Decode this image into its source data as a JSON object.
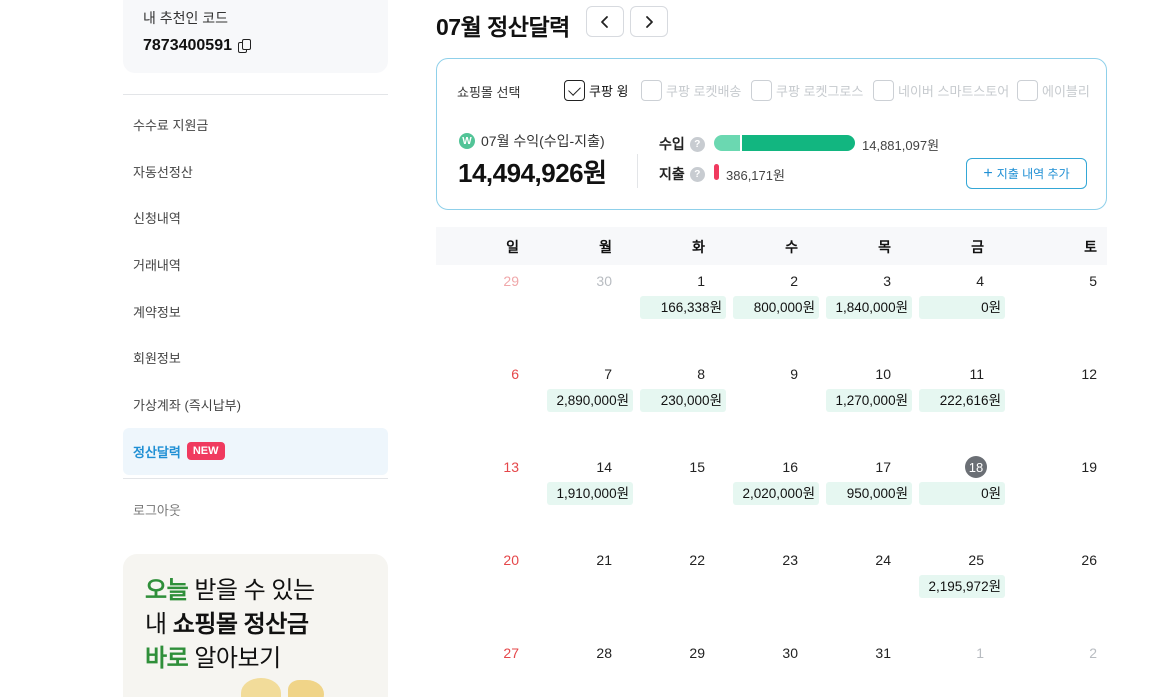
{
  "sidebar": {
    "referral_title": "내 추천인 코드",
    "referral_code": "7873400591",
    "menu": [
      {
        "label": "수수료 지원금",
        "active": false
      },
      {
        "label": "자동선정산",
        "active": false
      },
      {
        "label": "신청내역",
        "active": false
      },
      {
        "label": "거래내역",
        "active": false
      },
      {
        "label": "계약정보",
        "active": false
      },
      {
        "label": "회원정보",
        "active": false
      },
      {
        "label": "가상계좌 (즉시납부)",
        "active": false
      },
      {
        "label": "정산달력",
        "active": true,
        "badge": "NEW"
      }
    ],
    "logout": "로그아웃",
    "promo": {
      "l1a": "오늘",
      "l1b": " 받을 수 있는",
      "l2a": "내 ",
      "l2b": "쇼핑몰 정산금",
      "l3a": "바로",
      "l3b": " 알아보기"
    }
  },
  "header": {
    "title": "07월 정산달력"
  },
  "summary": {
    "mall_label": "쇼핑몰 선택",
    "malls": [
      {
        "label": "쿠팡 윙",
        "checked": true
      },
      {
        "label": "쿠팡 로켓배송",
        "checked": false
      },
      {
        "label": "쿠팡 로켓그로스",
        "checked": false
      },
      {
        "label": "네이버 스마트스토어",
        "checked": false
      },
      {
        "label": "에이블리",
        "checked": false
      }
    ],
    "profit_label": "07월 수익(수입-지출)",
    "profit_amount": "14,494,926원",
    "income_label": "수입",
    "income_value": "14,881,097원",
    "expense_label": "지출",
    "expense_value": "386,171원",
    "add_button": "지출 내역 추가",
    "won_symbol": "W",
    "help_symbol": "?"
  },
  "calendar": {
    "weekdays": [
      "일",
      "월",
      "화",
      "수",
      "목",
      "금",
      "토"
    ],
    "weeks": [
      [
        {
          "d": "29",
          "out": true
        },
        {
          "d": "30",
          "out": true
        },
        {
          "d": "1",
          "amt": "166,338원"
        },
        {
          "d": "2",
          "amt": "800,000원"
        },
        {
          "d": "3",
          "amt": "1,840,000원"
        },
        {
          "d": "4",
          "amt": "0원"
        },
        {
          "d": "5"
        }
      ],
      [
        {
          "d": "6"
        },
        {
          "d": "7",
          "amt": "2,890,000원"
        },
        {
          "d": "8",
          "amt": "230,000원"
        },
        {
          "d": "9"
        },
        {
          "d": "10",
          "amt": "1,270,000원"
        },
        {
          "d": "11",
          "amt": "222,616원"
        },
        {
          "d": "12"
        }
      ],
      [
        {
          "d": "13"
        },
        {
          "d": "14",
          "amt": "1,910,000원"
        },
        {
          "d": "15"
        },
        {
          "d": "16",
          "amt": "2,020,000원"
        },
        {
          "d": "17",
          "amt": "950,000원"
        },
        {
          "d": "18",
          "today": true,
          "amt": "0원"
        },
        {
          "d": "19"
        }
      ],
      [
        {
          "d": "20"
        },
        {
          "d": "21"
        },
        {
          "d": "22"
        },
        {
          "d": "23"
        },
        {
          "d": "24"
        },
        {
          "d": "25",
          "amt": "2,195,972원"
        },
        {
          "d": "26"
        }
      ],
      [
        {
          "d": "27"
        },
        {
          "d": "28"
        },
        {
          "d": "29"
        },
        {
          "d": "30"
        },
        {
          "d": "31"
        },
        {
          "d": "1",
          "out": true
        },
        {
          "d": "2",
          "out": true
        }
      ]
    ]
  },
  "colors": {
    "accent": "#1f8fd4",
    "income_light": "#6bd8b1",
    "income": "#12b680",
    "expense": "#f03a5f",
    "amount_bg": "#e6f7f1",
    "sunday": "#e5474a"
  }
}
